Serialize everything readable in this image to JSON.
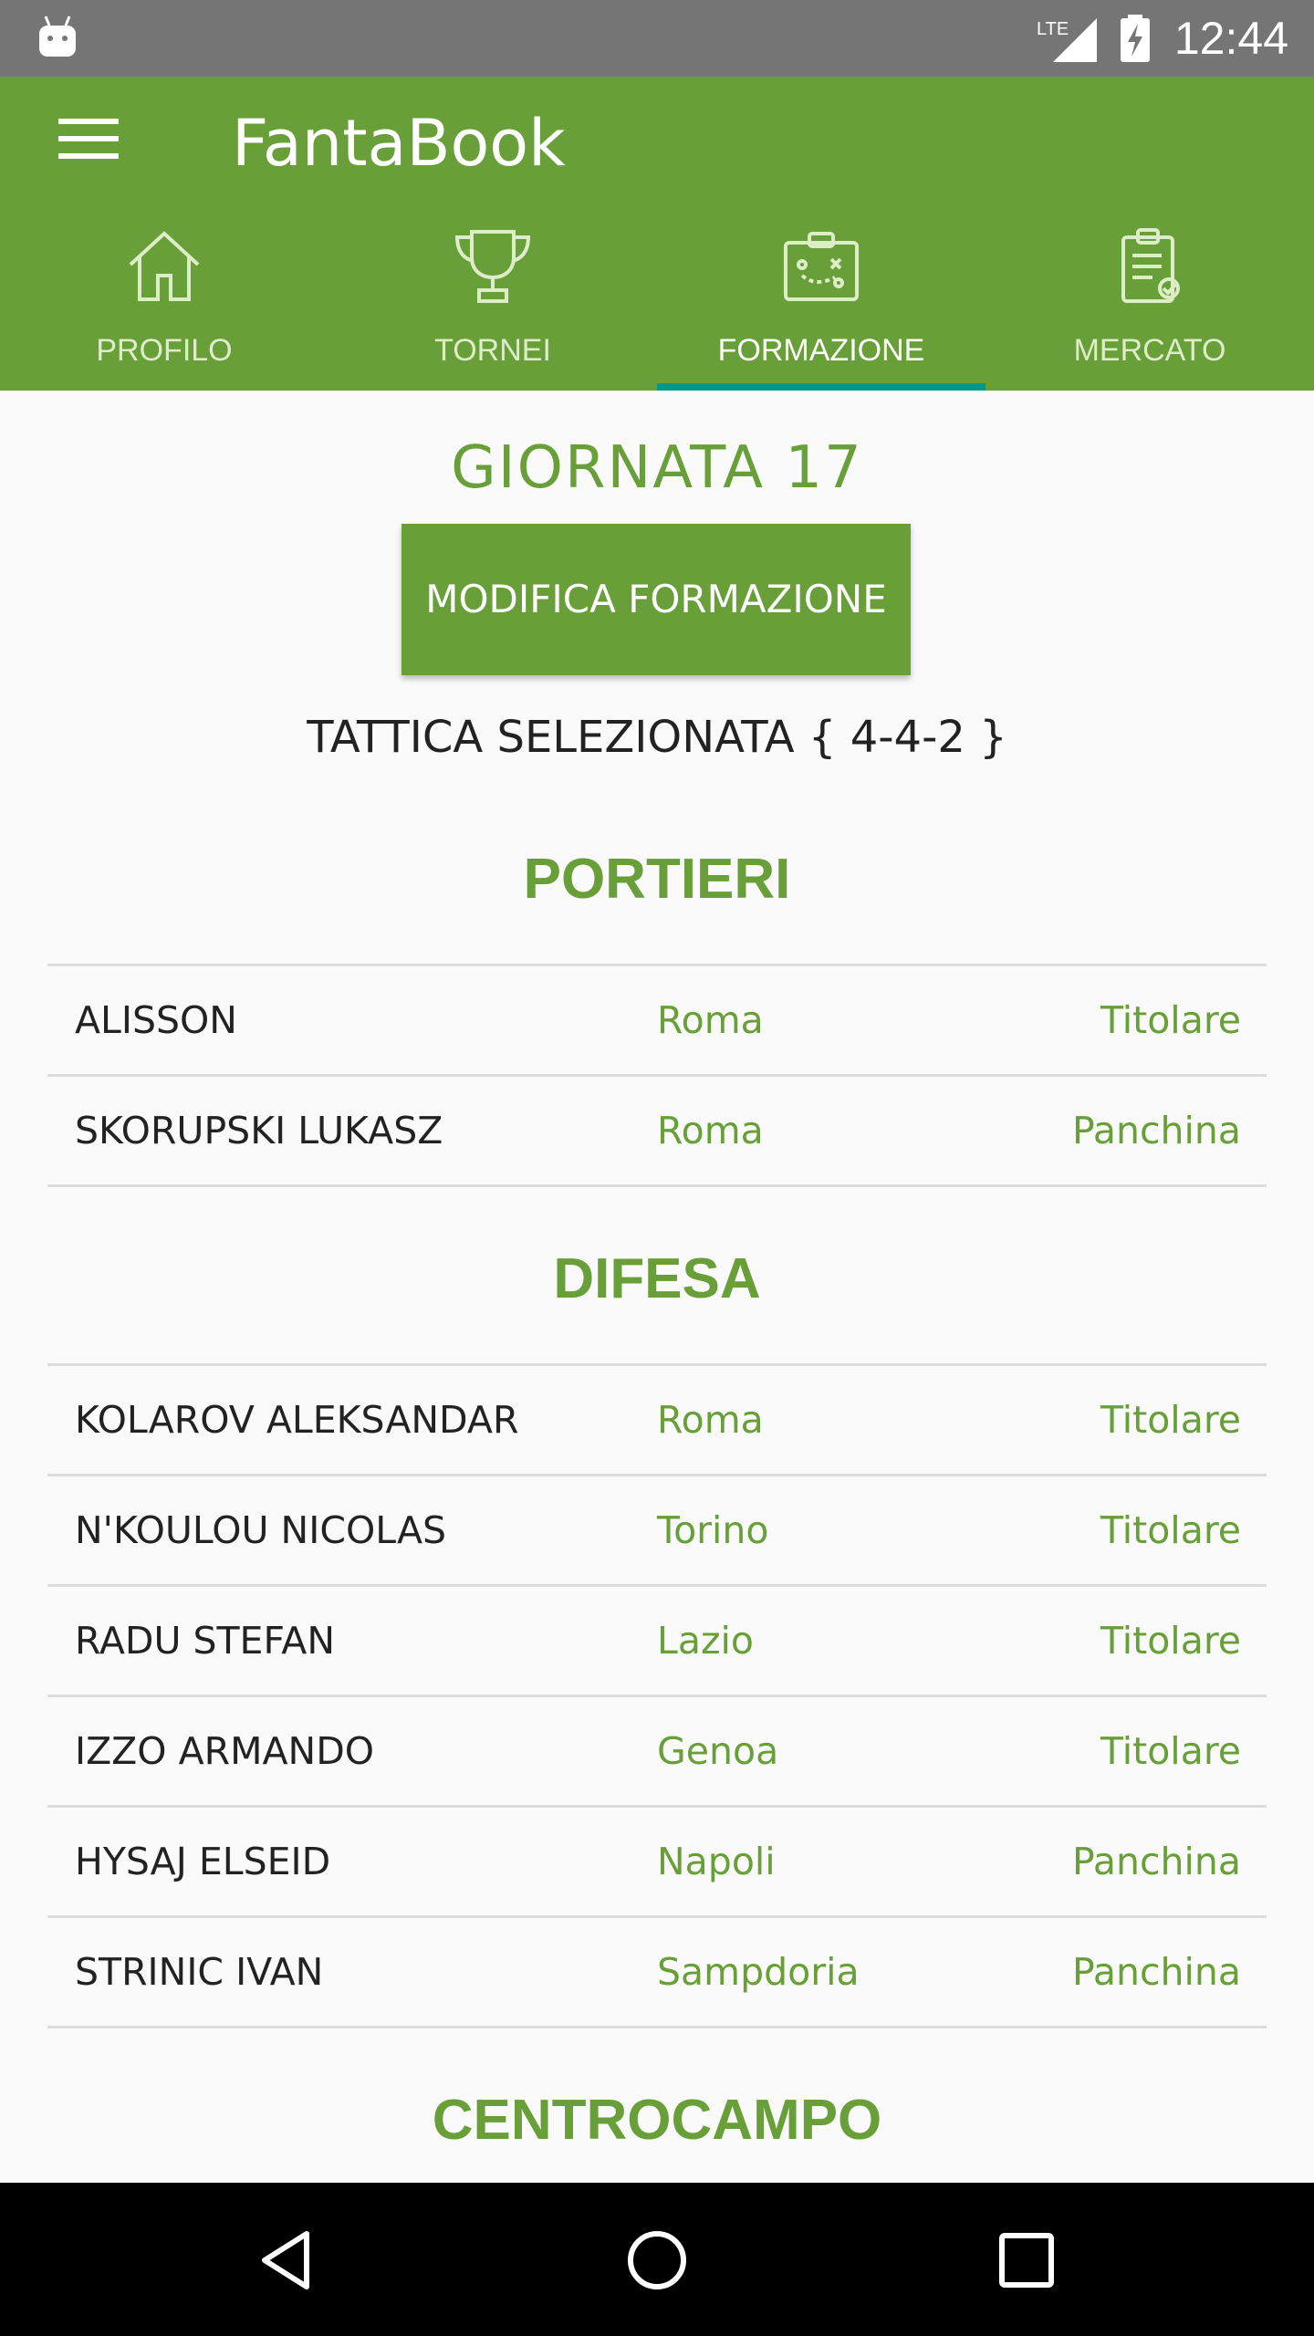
{
  "status_bar": {
    "time": "12:44",
    "network": "LTE",
    "left_icon": "android-notification-icon",
    "signal_icon": "lte-signal-icon",
    "battery_icon": "battery-charging-icon"
  },
  "app_bar": {
    "title": "FantaBook",
    "menu_icon": "hamburger-menu-icon",
    "background": "#689f38",
    "indicator_color": "#009688"
  },
  "tabs": [
    {
      "label": "PROFILO",
      "icon": "home-icon",
      "active": false
    },
    {
      "label": "TORNEI",
      "icon": "trophy-icon",
      "active": false
    },
    {
      "label": "FORMAZIONE",
      "icon": "tactics-board-icon",
      "active": true
    },
    {
      "label": "MERCATO",
      "icon": "clipboard-icon",
      "active": false
    }
  ],
  "header": {
    "giornata": "GIORNATA 17",
    "edit_button": "MODIFICA FORMAZIONE",
    "tattica": "TATTICA SELEZIONATA { 4-4-2 }"
  },
  "sections": [
    {
      "title": "PORTIERI",
      "players": [
        {
          "name": "ALISSON",
          "team": "Roma",
          "status": "Titolare"
        },
        {
          "name": "SKORUPSKI LUKASZ",
          "team": "Roma",
          "status": "Panchina"
        }
      ]
    },
    {
      "title": "DIFESA",
      "players": [
        {
          "name": "KOLAROV ALEKSANDAR",
          "team": "Roma",
          "status": "Titolare"
        },
        {
          "name": "N'KOULOU NICOLAS",
          "team": "Torino",
          "status": "Titolare"
        },
        {
          "name": "RADU STEFAN",
          "team": "Lazio",
          "status": "Titolare"
        },
        {
          "name": "IZZO ARMANDO",
          "team": "Genoa",
          "status": "Titolare"
        },
        {
          "name": "HYSAJ ELSEID",
          "team": "Napoli",
          "status": "Panchina"
        },
        {
          "name": "STRINIC IVAN",
          "team": "Sampdoria",
          "status": "Panchina"
        }
      ]
    },
    {
      "title": "CENTROCAMPO",
      "players": []
    }
  ],
  "nav_bar": {
    "back_icon": "back-triangle-icon",
    "home_icon": "home-circle-icon",
    "recents_icon": "recents-square-icon"
  }
}
